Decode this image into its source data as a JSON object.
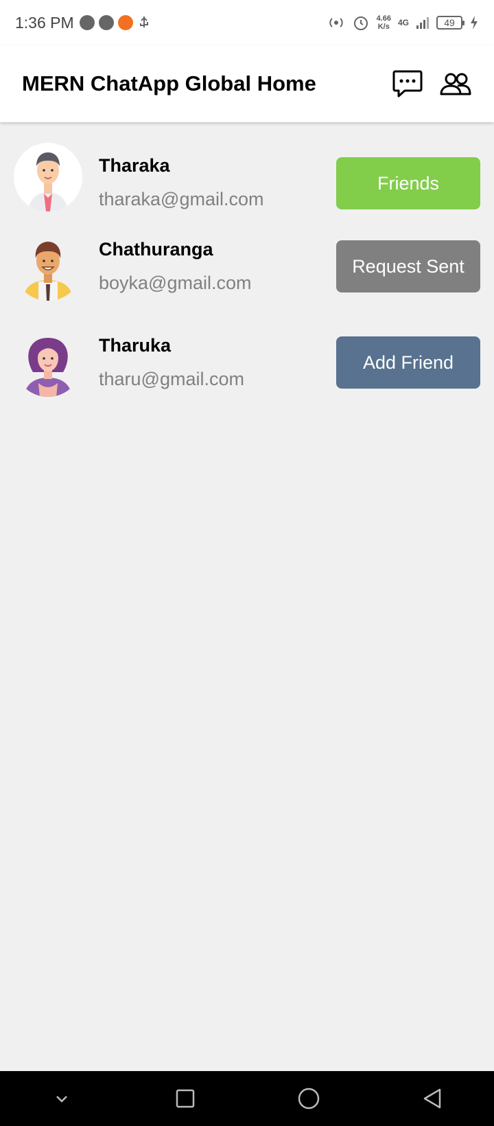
{
  "status_bar": {
    "time": "1:36 PM",
    "speed_value": "4.66",
    "speed_unit": "K/s",
    "network": "4G",
    "battery": "49"
  },
  "app_bar": {
    "title": "MERN ChatApp Global Home",
    "chat_icon": "chat-bubble-icon",
    "friends_icon": "people-icon"
  },
  "users": [
    {
      "name": "Tharaka",
      "email": "tharaka@gmail.com",
      "button_label": "Friends",
      "button_color": "#82cd4a"
    },
    {
      "name": "Chathuranga",
      "email": "boyka@gmail.com",
      "button_label": "Request Sent",
      "button_color": "#808080"
    },
    {
      "name": "Tharuka",
      "email": "tharu@gmail.com",
      "button_label": "Add Friend",
      "button_color": "#58728f"
    }
  ]
}
